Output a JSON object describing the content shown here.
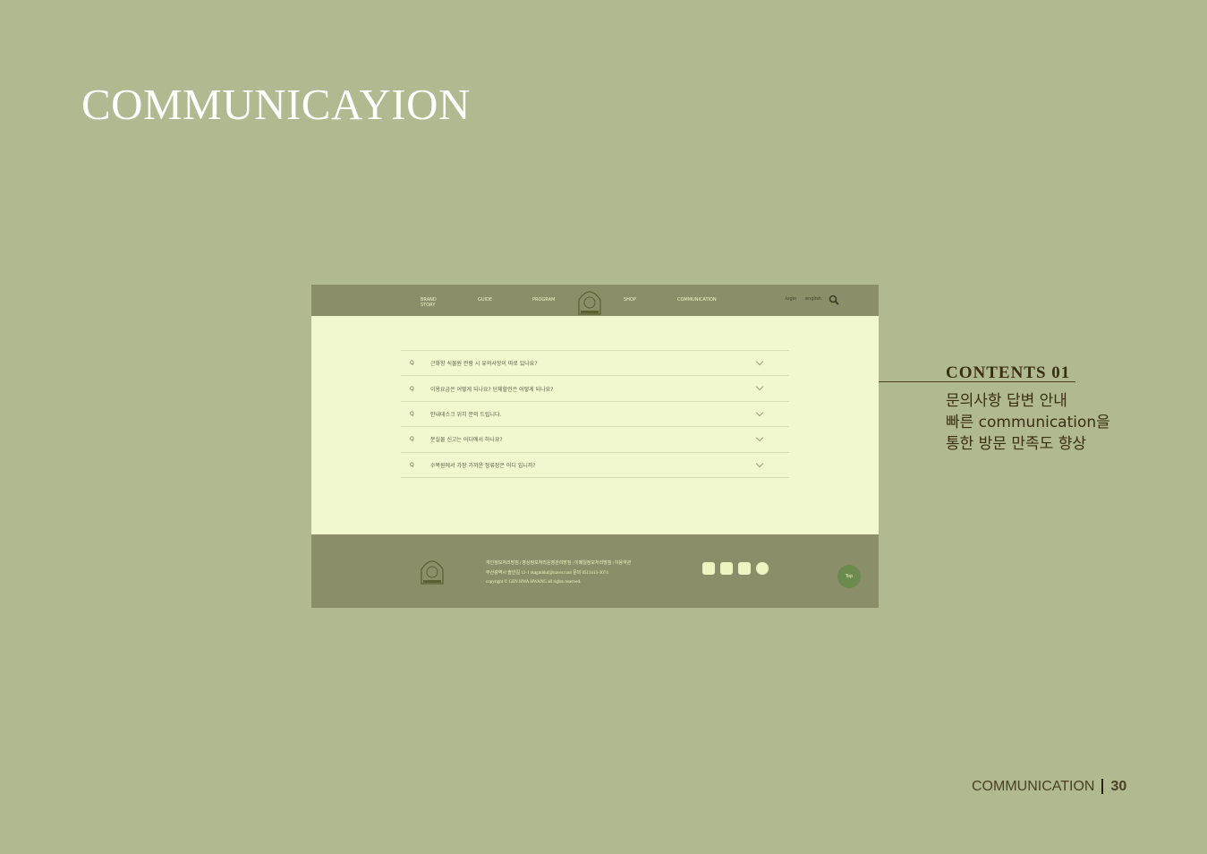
{
  "page": {
    "title": "COMMUNICAYION"
  },
  "nav": {
    "items": [
      "BRAND STORY",
      "GUIDE",
      "PROGRAM",
      "SHOP",
      "COMMUNICATION"
    ],
    "login": "login",
    "english": "english",
    "search_icon": "search-icon"
  },
  "faq": [
    {
      "q": "Q",
      "text": "근화향 식물원 관람 시 유의사항이 따로 있나요?"
    },
    {
      "q": "Q",
      "text": "이용요금은 어떻게 되나요? 단체할인은 어떻게 되나요?"
    },
    {
      "q": "Q",
      "text": "안내데스크 위치 문의 드립니다."
    },
    {
      "q": "Q",
      "text": "분실물 신고는 어디에서 하나요?"
    },
    {
      "q": "Q",
      "text": "수목원에서 가장 가까운 정류장은 어디 입니까?"
    }
  ],
  "footer": {
    "links": "개인정보처리방침 | 영상정보처리운영관리방침 | 이메일정보처리방침 | 이용약관",
    "address": "부산광역시 솔안길 12-1 rkagmlduf@naver.com 문의 0513413-3074",
    "copyright": "copyright © GEN HWA HWANG all rights reserved.",
    "social": [
      "instagram-icon",
      "youtube-icon",
      "twitter-icon",
      "kakaotalk-icon"
    ],
    "top": "Top"
  },
  "contents": {
    "title": "CONTENTS 01",
    "lines": [
      "문의사항 답변 안내",
      "빠른 communication을",
      "통한 방문 만족도 향상"
    ]
  },
  "pager": {
    "section": "COMMUNICATION",
    "page": "30"
  }
}
